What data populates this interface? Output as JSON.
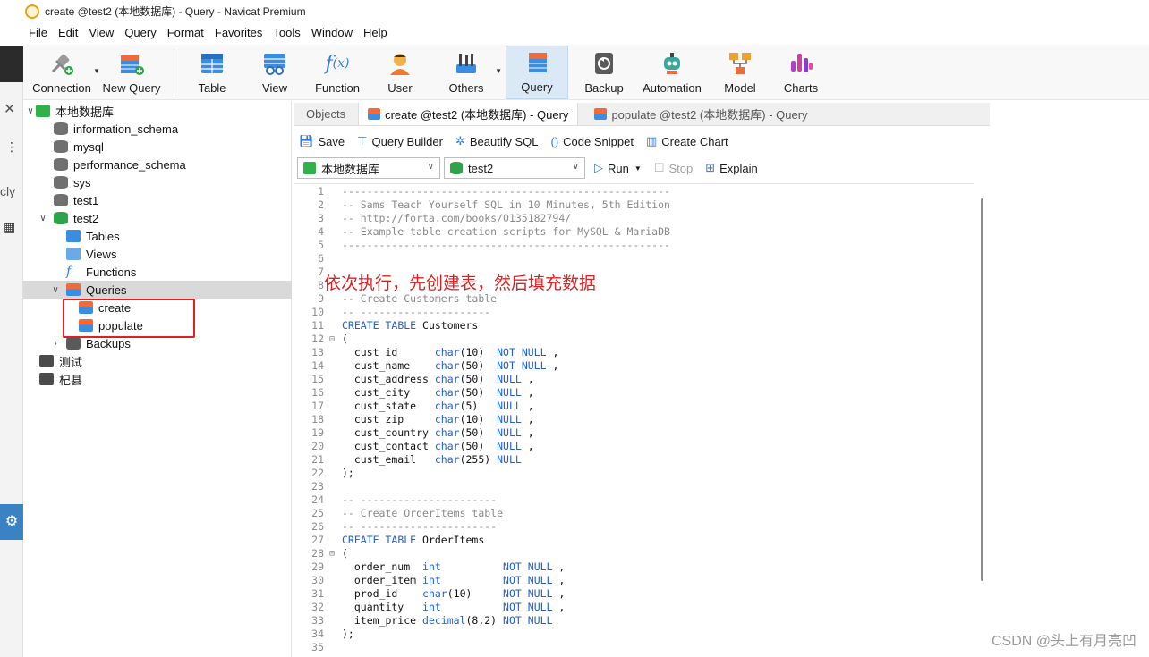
{
  "window": {
    "title": "create @test2 (本地数据库) - Query - Navicat Premium"
  },
  "menu": [
    "File",
    "Edit",
    "View",
    "Query",
    "Format",
    "Favorites",
    "Tools",
    "Window",
    "Help"
  ],
  "toolbar": {
    "items": [
      {
        "label": "Connection",
        "icon": "connection-icon"
      },
      {
        "label": "New Query",
        "icon": "new-query-icon"
      },
      {
        "label": "Table",
        "icon": "table-icon"
      },
      {
        "label": "View",
        "icon": "view-icon"
      },
      {
        "label": "Function",
        "icon": "function-icon"
      },
      {
        "label": "User",
        "icon": "user-icon"
      },
      {
        "label": "Others",
        "icon": "others-icon"
      },
      {
        "label": "Query",
        "icon": "query-icon",
        "active": true
      },
      {
        "label": "Backup",
        "icon": "backup-icon"
      },
      {
        "label": "Automation",
        "icon": "automation-icon"
      },
      {
        "label": "Model",
        "icon": "model-icon"
      },
      {
        "label": "Charts",
        "icon": "charts-icon"
      }
    ]
  },
  "navigator": {
    "connection": "本地数据库",
    "databases": [
      "information_schema",
      "mysql",
      "performance_schema",
      "sys",
      "test1",
      "test2"
    ],
    "test2_children": [
      "Tables",
      "Views",
      "Functions",
      "Queries"
    ],
    "queries": [
      "create",
      "populate"
    ],
    "backups": "Backups",
    "other_connections": [
      "测试",
      "杞县"
    ]
  },
  "tabs": [
    "Objects",
    "create @test2 (本地数据库) - Query",
    "populate @test2 (本地数据库) - Query"
  ],
  "editor_toolbar": {
    "save": "Save",
    "query_builder": "Query Builder",
    "beautify": "Beautify SQL",
    "code_snippet": "Code Snippet",
    "create_chart": "Create Chart",
    "run": "Run",
    "stop": "Stop",
    "explain": "Explain"
  },
  "connection_select": "本地数据库",
  "database_select": "test2",
  "annotation": "依次执行，先创建表，然后填充数据",
  "watermark": "CSDN @头上有月亮凹",
  "code": [
    "-----------------------------------------------------",
    "-- Sams Teach Yourself SQL in 10 Minutes, 5th Edition",
    "-- http://forta.com/books/0135182794/",
    "-- Example table creation scripts for MySQL & MariaDB",
    "-----------------------------------------------------",
    "",
    "",
    "",
    "-- Create Customers table",
    "-- ---------------------",
    "CREATE TABLE Customers",
    "(",
    "  cust_id      char(10)  NOT NULL ,",
    "  cust_name    char(50)  NOT NULL ,",
    "  cust_address char(50)  NULL ,",
    "  cust_city    char(50)  NULL ,",
    "  cust_state   char(5)   NULL ,",
    "  cust_zip     char(10)  NULL ,",
    "  cust_country char(50)  NULL ,",
    "  cust_contact char(50)  NULL ,",
    "  cust_email   char(255) NULL",
    ");",
    "",
    "-- ----------------------",
    "-- Create OrderItems table",
    "-- ----------------------",
    "CREATE TABLE OrderItems",
    "(",
    "  order_num  int          NOT NULL ,",
    "  order_item int          NOT NULL ,",
    "  prod_id    char(10)     NOT NULL ,",
    "  quantity   int          NOT NULL ,",
    "  item_price decimal(8,2) NOT NULL",
    ");",
    ""
  ],
  "colors": {
    "accent": "#2f7bd6",
    "annotation": "#e02020",
    "selected_row": "#d9d9d9",
    "active_tool": "#dbe8f6"
  }
}
